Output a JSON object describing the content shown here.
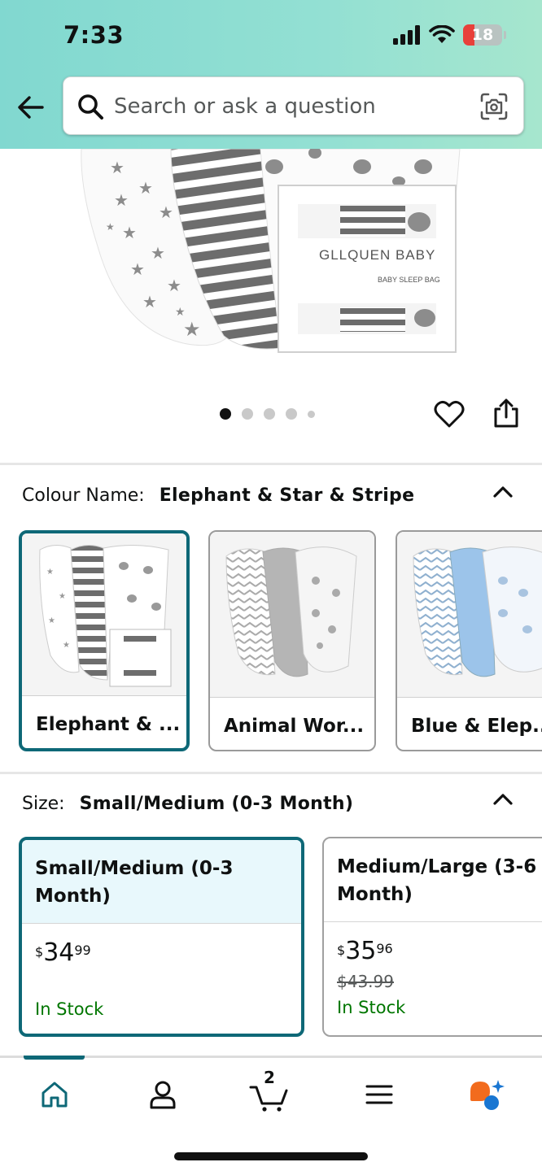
{
  "status_bar": {
    "time": "7:33",
    "battery": "18"
  },
  "search": {
    "placeholder": "Search or ask a question"
  },
  "hero": {
    "box_brand": "GLLQUEN BABY",
    "box_product": "BABY SLEEP BAG",
    "image_count": 5,
    "active_index": 0
  },
  "colour": {
    "label": "Colour Name:",
    "selected_value": "Elephant & Star & Stripe",
    "options": [
      {
        "label": "Elephant & ...",
        "selected": true
      },
      {
        "label": "Animal Wor...",
        "selected": false
      },
      {
        "label": "Blue & Elep...",
        "selected": false
      }
    ]
  },
  "size": {
    "label": "Size:",
    "selected_value": "Small/Medium (0-3 Month)",
    "options": [
      {
        "name": "Small/Medium (0-3 Month)",
        "currency": "$",
        "price_whole": "34",
        "price_fraction": "99",
        "list_price": "",
        "stock": "In Stock",
        "selected": true
      },
      {
        "name": "Medium/Large (3-6 Month)",
        "currency": "$",
        "price_whole": "35",
        "price_fraction": "96",
        "list_price": "$43.99",
        "stock": "In Stock",
        "selected": false
      }
    ]
  },
  "bottom_nav": {
    "items": [
      {
        "icon": "home-icon",
        "active": true
      },
      {
        "icon": "account-icon",
        "active": false
      },
      {
        "icon": "cart-icon",
        "active": false
      },
      {
        "icon": "menu-icon",
        "active": false
      },
      {
        "icon": "rufus-assistant-icon",
        "active": false
      }
    ],
    "cart_count": "2"
  },
  "colors": {
    "accent": "#0e6877",
    "header_start": "#81d8d0",
    "in_stock": "#007600",
    "selected_size_bg": "#e8f8fc"
  }
}
